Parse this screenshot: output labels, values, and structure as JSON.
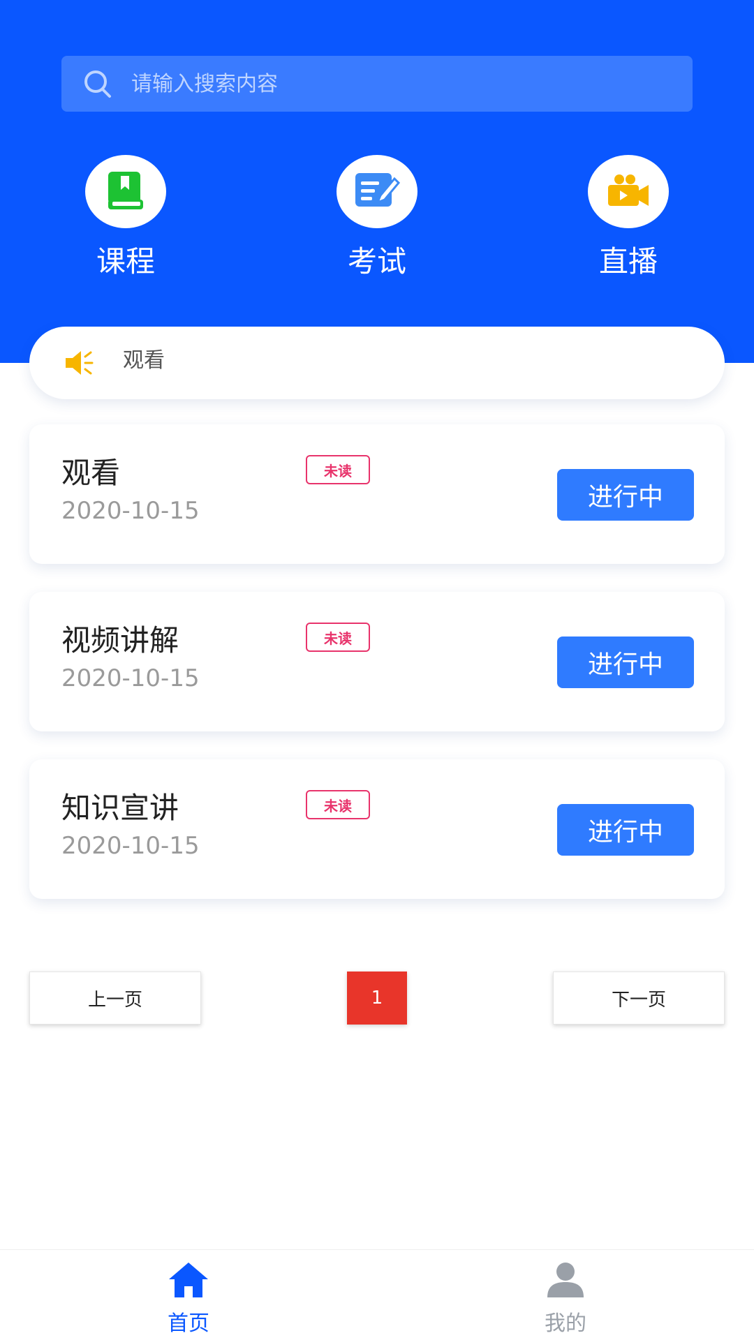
{
  "colors": {
    "header_bg": "#0A57FF",
    "search_bg": "#3A7BFF",
    "status_button": "#2F7BFF",
    "unread_badge": "#E8336B",
    "current_page": "#E8352A",
    "tab_active": "#0A57FF",
    "tab_inactive": "#9AA0A8"
  },
  "search": {
    "placeholder": "请输入搜索内容",
    "icon": "search-icon"
  },
  "quick_nav": [
    {
      "label": "课程",
      "icon": "book-icon"
    },
    {
      "label": "考试",
      "icon": "edit-icon"
    },
    {
      "label": "直播",
      "icon": "video-camera-icon"
    }
  ],
  "notice": {
    "text": "观看",
    "icon": "speaker-icon"
  },
  "items": [
    {
      "title": "观看",
      "date": "2020-10-15",
      "badge": "未读",
      "status": "进行中"
    },
    {
      "title": "视频讲解",
      "date": "2020-10-15",
      "badge": "未读",
      "status": "进行中"
    },
    {
      "title": "知识宣讲",
      "date": "2020-10-15",
      "badge": "未读",
      "status": "进行中"
    }
  ],
  "pagination": {
    "prev": "上一页",
    "current": "1",
    "next": "下一页"
  },
  "tabbar": [
    {
      "label": "首页",
      "icon": "home-icon",
      "active": true
    },
    {
      "label": "我的",
      "icon": "user-icon",
      "active": false
    }
  ]
}
